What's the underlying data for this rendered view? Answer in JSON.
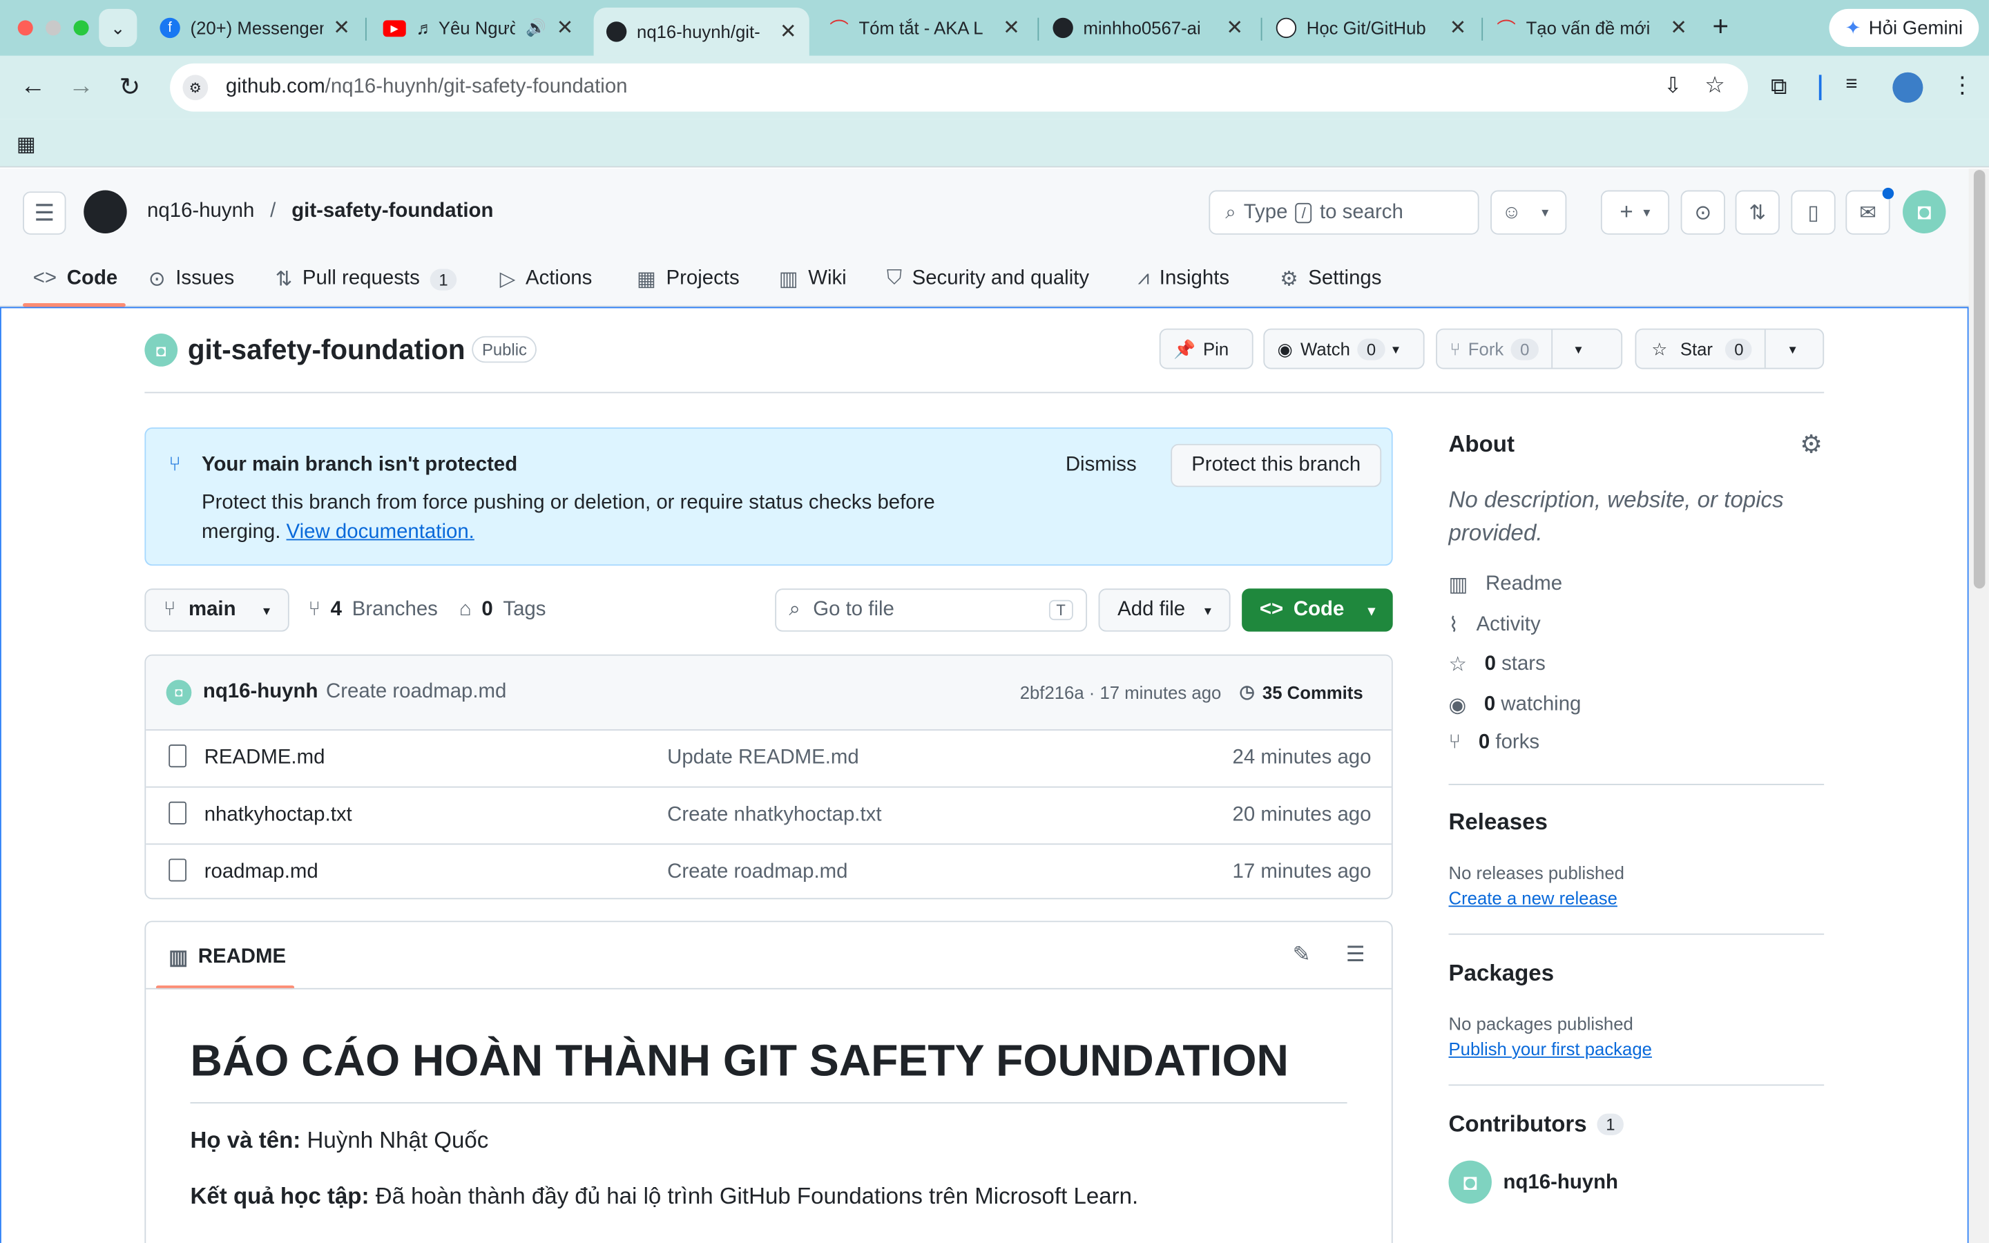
{
  "browser": {
    "tabs": [
      {
        "title": "(20+) Messenger",
        "icon": "facebook-icon"
      },
      {
        "title": "♬ Yêu Người",
        "icon": "youtube-icon"
      },
      {
        "title": "nq16-huynh/git-",
        "icon": "github-icon"
      },
      {
        "title": "Tóm tắt - AKA L",
        "icon": "aka-icon"
      },
      {
        "title": "minhho0567-ai",
        "icon": "github-icon"
      },
      {
        "title": "Học Git/GitHub",
        "icon": "chatgpt-icon"
      },
      {
        "title": "Tạo vấn đề mới",
        "icon": "aka-icon"
      }
    ],
    "gemini_label": "Hỏi Gemini",
    "url_host": "github.com",
    "url_path": "/nq16-huynh/git-safety-foundation"
  },
  "header": {
    "owner": "nq16-huynh",
    "sep": "/",
    "repo": "git-safety-foundation",
    "search_type": "Type",
    "search_key": "/",
    "search_rest": "to search"
  },
  "nav": [
    {
      "label": "Code"
    },
    {
      "label": "Issues"
    },
    {
      "label": "Pull requests",
      "count": "1"
    },
    {
      "label": "Actions"
    },
    {
      "label": "Projects"
    },
    {
      "label": "Wiki"
    },
    {
      "label": "Security and quality"
    },
    {
      "label": "Insights"
    },
    {
      "label": "Settings"
    }
  ],
  "repo": {
    "name": "git-safety-foundation",
    "visibility": "Public",
    "pin": "Pin",
    "watch": "Watch",
    "watch_count": "0",
    "fork": "Fork",
    "fork_count": "0",
    "star": "Star",
    "star_count": "0"
  },
  "flash": {
    "title": "Your main branch isn't protected",
    "body": "Protect this branch from force pushing or deletion, or require status checks before merging.",
    "link": "View documentation.",
    "dismiss": "Dismiss",
    "protect": "Protect this branch"
  },
  "branchbar": {
    "branch": "main",
    "branches_count": "4",
    "branches_label": "Branches",
    "tags_count": "0",
    "tags_label": "Tags",
    "goto_placeholder": "Go to file",
    "goto_key": "T",
    "add_file": "Add file",
    "code": "Code"
  },
  "commit": {
    "author": "nq16-huynh",
    "message": "Create roadmap.md",
    "sha_time": "2bf216a · 17 minutes ago",
    "commits": "35 Commits"
  },
  "files": [
    {
      "name": "README.md",
      "message": "Update README.md",
      "time": "24 minutes ago"
    },
    {
      "name": "nhatkyhoctap.txt",
      "message": "Create nhatkyhoctap.txt",
      "time": "20 minutes ago"
    },
    {
      "name": "roadmap.md",
      "message": "Create roadmap.md",
      "time": "17 minutes ago"
    }
  ],
  "readme": {
    "tab": "README",
    "h1": "BÁO CÁO HOÀN THÀNH GIT SAFETY FOUNDATION",
    "name_label": "Họ và tên:",
    "name_value": "Huỳnh Nhật Quốc",
    "result_label": "Kết quả học tập:",
    "result_value": "Đã hoàn thành đầy đủ hai lộ trình GitHub Foundations trên Microsoft Learn."
  },
  "about": {
    "title": "About",
    "desc": "No description, website, or topics provided.",
    "readme": "Readme",
    "activity": "Activity",
    "stars_n": "0",
    "stars": "stars",
    "watching_n": "0",
    "watching": "watching",
    "forks_n": "0",
    "forks": "forks"
  },
  "releases": {
    "title": "Releases",
    "empty": "No releases published",
    "link": "Create a new release"
  },
  "packages": {
    "title": "Packages",
    "empty": "No packages published",
    "link": "Publish your first package"
  },
  "contributors": {
    "title": "Contributors",
    "count": "1",
    "name": "nq16-huynh"
  },
  "colors": {
    "green": "#1f883d",
    "blue": "#0969da",
    "flash": "#ddf4ff",
    "tab_bar": "#a8dada"
  }
}
